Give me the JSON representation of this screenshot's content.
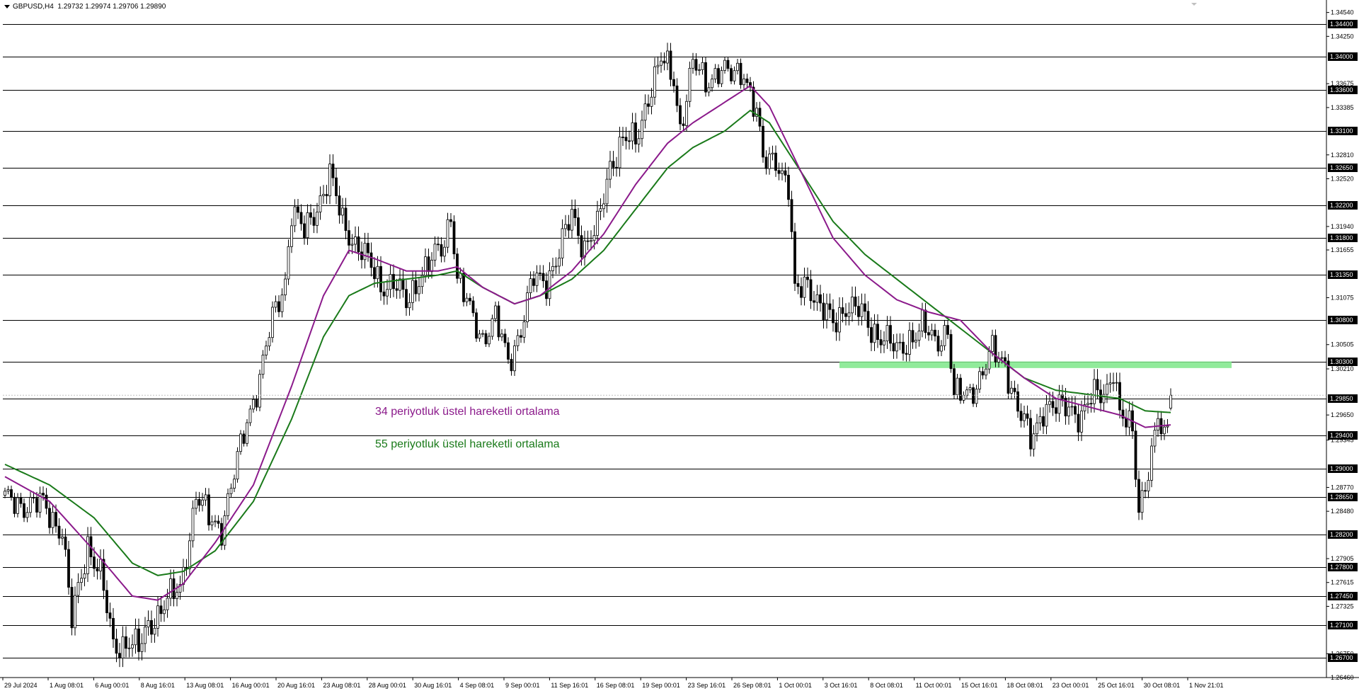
{
  "header": {
    "symbol": "GBPUSD,H4",
    "open": "1.29732",
    "high": "1.29974",
    "low": "1.29706",
    "close": "1.29890"
  },
  "chart_data": {
    "type": "candlestick",
    "ylim": [
      1.2646,
      1.3464
    ],
    "grid": false,
    "colors": {
      "background": "#ffffff",
      "candle": "#000000",
      "ema34": "#8b1a8b",
      "ema55": "#1a7a1a",
      "zone": "#7ee88a",
      "level_line": "#000000"
    },
    "axis_ticks": [
      "1.34540",
      "1.34250",
      "1.33675",
      "1.33385",
      "1.32810",
      "1.32520",
      "1.31940",
      "1.31655",
      "1.31075",
      "1.30505",
      "1.30210",
      "1.29650",
      "1.29345",
      "1.28770",
      "1.28480",
      "1.27905",
      "1.27615",
      "1.27325",
      "1.26750",
      "1.26460"
    ],
    "levels": [
      "1.34400",
      "1.34000",
      "1.33600",
      "1.33100",
      "1.32650",
      "1.32200",
      "1.31800",
      "1.31350",
      "1.30800",
      "1.30300",
      "1.29850",
      "1.29400",
      "1.29000",
      "1.28650",
      "1.28200",
      "1.27800",
      "1.27450",
      "1.27100",
      "1.26700"
    ],
    "x_labels": [
      "29 Jul 2024",
      "1 Aug 08:01",
      "6 Aug 00:01",
      "8 Aug 16:01",
      "13 Aug 08:01",
      "16 Aug 00:01",
      "20 Aug 16:01",
      "23 Aug 08:01",
      "28 Aug 00:01",
      "30 Aug 16:01",
      "4 Sep 08:01",
      "9 Sep 00:01",
      "11 Sep 16:01",
      "16 Sep 08:01",
      "19 Sep 00:01",
      "23 Sep 16:01",
      "26 Sep 08:01",
      "1 Oct 00:01",
      "3 Oct 16:01",
      "8 Oct 08:01",
      "11 Oct 00:01",
      "15 Oct 16:01",
      "18 Oct 08:01",
      "23 Oct 00:01",
      "25 Oct 16:01",
      "30 Oct 08:01",
      "1 Nov 21:01"
    ],
    "annotations": [
      {
        "text": "34 periyotluk üstel hareketli ortalama",
        "color": "#8b1a8b"
      },
      {
        "text": "55 periyotluk üstel hareketli ortalama",
        "color": "#1a7a1a"
      }
    ],
    "resistance_zone": [
      1.3022,
      1.303
    ],
    "anchors": [
      [
        0,
        1.286
      ],
      [
        12,
        1.2855
      ],
      [
        18,
        1.2825
      ],
      [
        21,
        1.2712
      ],
      [
        26,
        1.281
      ],
      [
        30,
        1.277
      ],
      [
        34,
        1.2685
      ],
      [
        39,
        1.269
      ],
      [
        42,
        1.2678
      ],
      [
        45,
        1.271
      ],
      [
        48,
        1.2725
      ],
      [
        55,
        1.2755
      ],
      [
        60,
        1.2865
      ],
      [
        64,
        1.284
      ],
      [
        68,
        1.283
      ],
      [
        72,
        1.289
      ],
      [
        76,
        1.296
      ],
      [
        80,
        1.301
      ],
      [
        84,
        1.308
      ],
      [
        88,
        1.313
      ],
      [
        90,
        1.3215
      ],
      [
        94,
        1.3185
      ],
      [
        98,
        1.322
      ],
      [
        102,
        1.3255
      ],
      [
        106,
        1.32
      ],
      [
        110,
        1.3175
      ],
      [
        114,
        1.315
      ],
      [
        118,
        1.3125
      ],
      [
        122,
        1.3125
      ],
      [
        126,
        1.31
      ],
      [
        130,
        1.3135
      ],
      [
        134,
        1.315
      ],
      [
        138,
        1.3175
      ],
      [
        140,
        1.3215
      ],
      [
        142,
        1.313
      ],
      [
        146,
        1.309
      ],
      [
        150,
        1.306
      ],
      [
        154,
        1.308
      ],
      [
        158,
        1.303
      ],
      [
        162,
        1.307
      ],
      [
        166,
        1.313
      ],
      [
        170,
        1.313
      ],
      [
        174,
        1.316
      ],
      [
        178,
        1.321
      ],
      [
        182,
        1.317
      ],
      [
        186,
        1.319
      ],
      [
        190,
        1.327
      ],
      [
        194,
        1.33
      ],
      [
        198,
        1.3295
      ],
      [
        202,
        1.3355
      ],
      [
        206,
        1.3395
      ],
      [
        210,
        1.3375
      ],
      [
        212,
        1.3315
      ],
      [
        216,
        1.339
      ],
      [
        220,
        1.337
      ],
      [
        224,
        1.3385
      ],
      [
        228,
        1.3375
      ],
      [
        232,
        1.3385
      ],
      [
        236,
        1.333
      ],
      [
        238,
        1.327
      ],
      [
        242,
        1.328
      ],
      [
        246,
        1.324
      ],
      [
        248,
        1.311
      ],
      [
        252,
        1.313
      ],
      [
        256,
        1.3095
      ],
      [
        260,
        1.3075
      ],
      [
        264,
        1.31
      ],
      [
        268,
        1.309
      ],
      [
        272,
        1.307
      ],
      [
        276,
        1.306
      ],
      [
        280,
        1.304
      ],
      [
        284,
        1.306
      ],
      [
        288,
        1.307
      ],
      [
        292,
        1.3055
      ],
      [
        296,
        1.307
      ],
      [
        298,
        1.2985
      ],
      [
        302,
        1.299
      ],
      [
        306,
        1.301
      ],
      [
        310,
        1.304
      ],
      [
        314,
        1.303
      ],
      [
        318,
        1.297
      ],
      [
        322,
        1.2935
      ],
      [
        326,
        1.2975
      ],
      [
        330,
        1.297
      ],
      [
        334,
        1.298
      ],
      [
        338,
        1.296
      ],
      [
        342,
        1.299
      ],
      [
        346,
        1.3
      ],
      [
        348,
        1.302
      ],
      [
        350,
        1.296
      ],
      [
        354,
        1.295
      ],
      [
        356,
        1.2855
      ],
      [
        358,
        1.288
      ],
      [
        360,
        1.291
      ],
      [
        362,
        1.296
      ],
      [
        364,
        1.2935
      ],
      [
        366,
        1.2989
      ]
    ],
    "ema34_anchors": [
      [
        0,
        1.289
      ],
      [
        14,
        1.286
      ],
      [
        28,
        1.28
      ],
      [
        40,
        1.2745
      ],
      [
        48,
        1.274
      ],
      [
        56,
        1.276
      ],
      [
        66,
        1.281
      ],
      [
        78,
        1.288
      ],
      [
        90,
        1.3
      ],
      [
        100,
        1.311
      ],
      [
        108,
        1.3165
      ],
      [
        116,
        1.3155
      ],
      [
        126,
        1.314
      ],
      [
        136,
        1.314
      ],
      [
        142,
        1.3145
      ],
      [
        150,
        1.312
      ],
      [
        160,
        1.31
      ],
      [
        168,
        1.311
      ],
      [
        178,
        1.314
      ],
      [
        188,
        1.3185
      ],
      [
        198,
        1.3245
      ],
      [
        208,
        1.3295
      ],
      [
        216,
        1.332
      ],
      [
        226,
        1.3345
      ],
      [
        234,
        1.3365
      ],
      [
        240,
        1.334
      ],
      [
        250,
        1.326
      ],
      [
        260,
        1.318
      ],
      [
        270,
        1.3135
      ],
      [
        280,
        1.3105
      ],
      [
        290,
        1.309
      ],
      [
        300,
        1.308
      ],
      [
        310,
        1.304
      ],
      [
        320,
        1.301
      ],
      [
        330,
        1.2985
      ],
      [
        340,
        1.2975
      ],
      [
        350,
        1.2965
      ],
      [
        358,
        1.295
      ],
      [
        366,
        1.2953
      ]
    ],
    "ema55_anchors": [
      [
        0,
        1.2905
      ],
      [
        14,
        1.288
      ],
      [
        28,
        1.284
      ],
      [
        40,
        1.2785
      ],
      [
        48,
        1.277
      ],
      [
        56,
        1.2775
      ],
      [
        66,
        1.28
      ],
      [
        78,
        1.286
      ],
      [
        90,
        1.296
      ],
      [
        100,
        1.306
      ],
      [
        108,
        1.311
      ],
      [
        116,
        1.3125
      ],
      [
        126,
        1.313
      ],
      [
        136,
        1.3135
      ],
      [
        142,
        1.314
      ],
      [
        150,
        1.312
      ],
      [
        160,
        1.31
      ],
      [
        168,
        1.311
      ],
      [
        178,
        1.313
      ],
      [
        188,
        1.3165
      ],
      [
        198,
        1.3215
      ],
      [
        208,
        1.3265
      ],
      [
        216,
        1.329
      ],
      [
        226,
        1.331
      ],
      [
        234,
        1.3335
      ],
      [
        240,
        1.332
      ],
      [
        250,
        1.326
      ],
      [
        260,
        1.32
      ],
      [
        270,
        1.316
      ],
      [
        280,
        1.313
      ],
      [
        290,
        1.31
      ],
      [
        300,
        1.307
      ],
      [
        310,
        1.304
      ],
      [
        320,
        1.301
      ],
      [
        330,
        1.2995
      ],
      [
        340,
        1.299
      ],
      [
        350,
        1.2985
      ],
      [
        358,
        1.297
      ],
      [
        366,
        1.2968
      ]
    ]
  }
}
